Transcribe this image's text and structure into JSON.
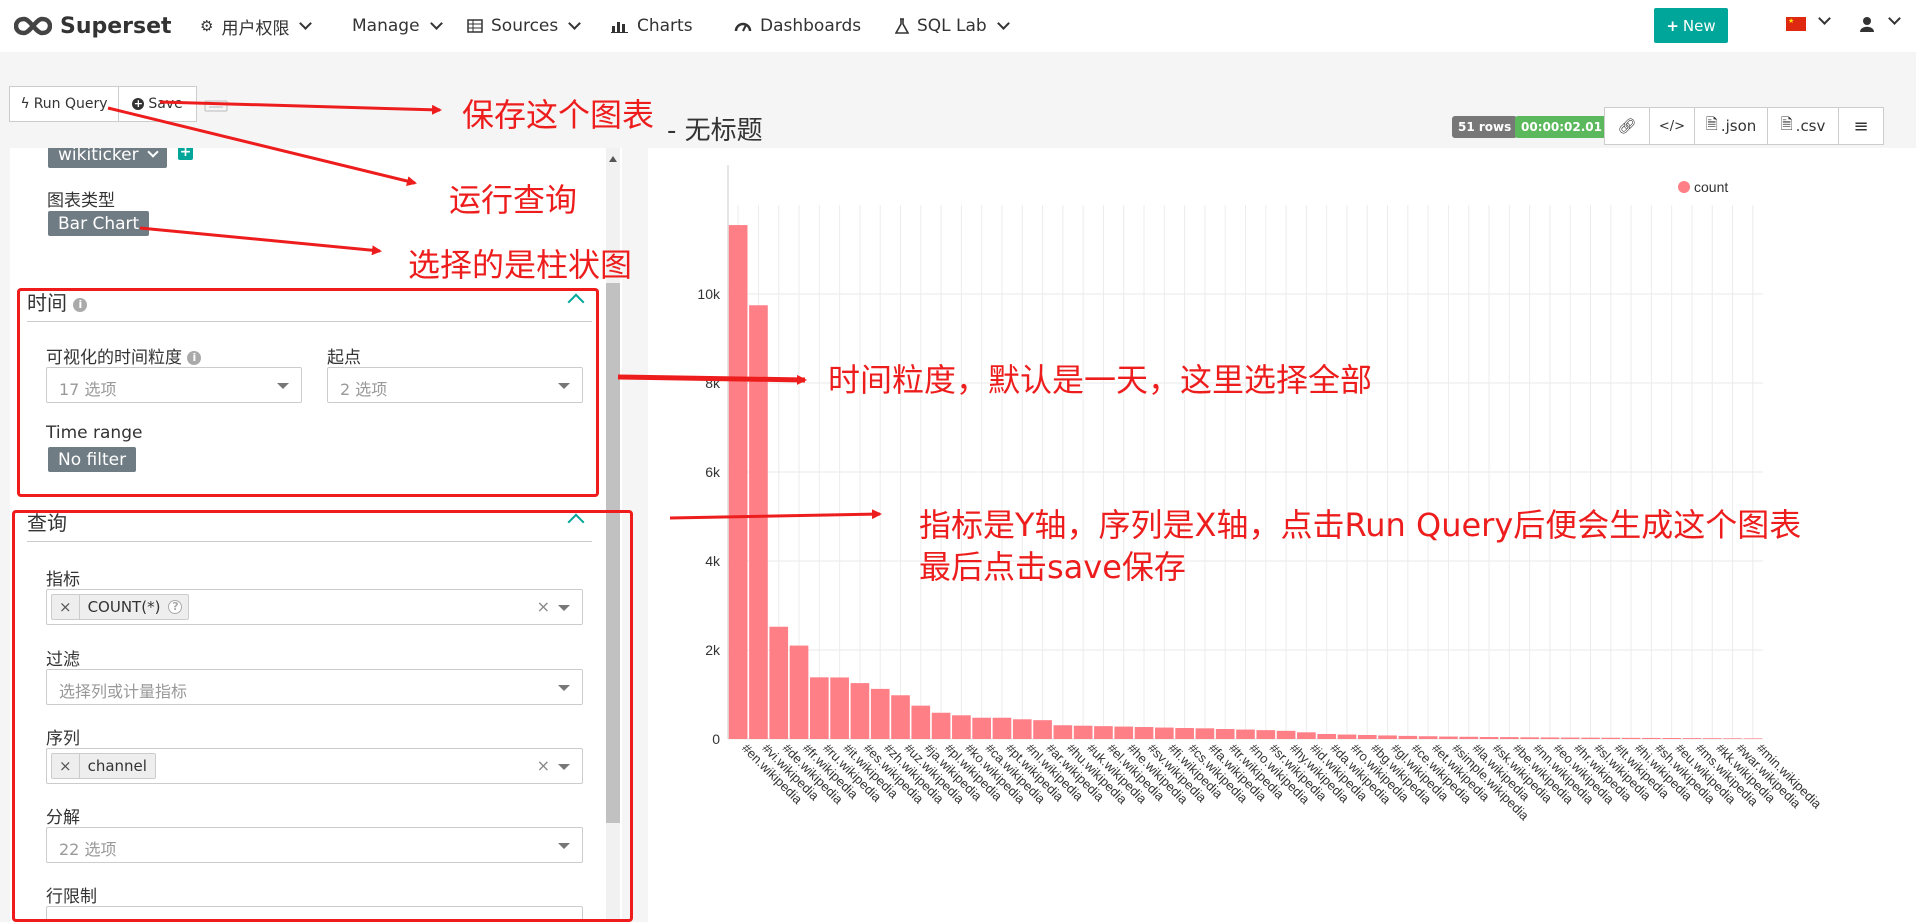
{
  "navbar": {
    "brand": "Superset",
    "items": [
      {
        "label": "用户权限",
        "dropdown": true
      },
      {
        "label": "Manage",
        "dropdown": true
      },
      {
        "label": "Sources",
        "dropdown": true
      },
      {
        "label": "Charts",
        "dropdown": false
      },
      {
        "label": "Dashboards",
        "dropdown": false
      },
      {
        "label": "SQL Lab",
        "dropdown": true
      }
    ],
    "new_button": "New",
    "accent_color": "#00a699"
  },
  "toolbar": {
    "run_query": "Run Query",
    "save": "Save"
  },
  "datasource": {
    "name": "wikiticker"
  },
  "viz": {
    "label": "图表类型",
    "type": "Bar Chart"
  },
  "time_section": {
    "title": "时间",
    "granularity_label": "可视化的时间粒度",
    "granularity_placeholder": "17 选项",
    "since_label": "起点",
    "since_placeholder": "2 选项",
    "time_range_label": "Time range",
    "time_range_value": "No filter"
  },
  "query_section": {
    "title": "查询",
    "metrics_label": "指标",
    "metrics_value": "COUNT(*)",
    "filters_label": "过滤",
    "filters_placeholder": "选择列或计量指标",
    "series_label": "序列",
    "series_value": "channel",
    "breakdown_label": "分解",
    "breakdown_placeholder": "22 选项",
    "row_limit_label": "行限制"
  },
  "chart_header": {
    "title": "- 无标题",
    "rows_badge": "51 rows",
    "time_badge": "00:00:02.01",
    "json_btn": ".json",
    "csv_btn": ".csv"
  },
  "annotations": {
    "save": "保存这个图表",
    "run": "运行查询",
    "chart_type": "选择的是柱状图",
    "time": "时间粒度，默认是一天，这里选择全部",
    "query_line1": "指标是Y轴，序列是X轴，点击Run Query后便会生成这个图表",
    "query_line2": "最后点击save保存",
    "color": "#ee1d1d"
  },
  "chart_data": {
    "type": "bar",
    "legend": "count",
    "legend_position": "top-right",
    "bar_color": "#ff7f87",
    "ylim": [
      0,
      12000
    ],
    "yticks": [
      0,
      2000,
      4000,
      6000,
      8000,
      10000
    ],
    "ytick_labels": [
      "0",
      "2k",
      "4k",
      "6k",
      "8k",
      "10k"
    ],
    "grid": true,
    "categories": [
      "#en.wikipedia",
      "#vi.wikipedia",
      "#de.wikipedia",
      "#fr.wikipedia",
      "#ru.wikipedia",
      "#it.wikipedia",
      "#es.wikipedia",
      "#zh.wikipedia",
      "#uz.wikipedia",
      "#ja.wikipedia",
      "#pl.wikipedia",
      "#ko.wikipedia",
      "#ca.wikipedia",
      "#pt.wikipedia",
      "#nl.wikipedia",
      "#ar.wikipedia",
      "#hu.wikipedia",
      "#uk.wikipedia",
      "#el.wikipedia",
      "#he.wikipedia",
      "#sv.wikipedia",
      "#fi.wikipedia",
      "#cs.wikipedia",
      "#fa.wikipedia",
      "#tr.wikipedia",
      "#no.wikipedia",
      "#sr.wikipedia",
      "#hy.wikipedia",
      "#id.wikipedia",
      "#da.wikipedia",
      "#ro.wikipedia",
      "#bg.wikipedia",
      "#gl.wikipedia",
      "#ce.wikipedia",
      "#et.wikipedia",
      "#simple.wikipedia",
      "#la.wikipedia",
      "#sk.wikipedia",
      "#be.wikipedia",
      "#nn.wikipedia",
      "#eo.wikipedia",
      "#hr.wikipedia",
      "#sl.wikipedia",
      "#lt.wikipedia",
      "#hi.wikipedia",
      "#sh.wikipedia",
      "#eu.wikipedia",
      "#ms.wikipedia",
      "#kk.wikipedia",
      "#war.wikipedia",
      "#min.wikipedia"
    ],
    "values": [
      11549,
      9747,
      2523,
      2099,
      1386,
      1383,
      1256,
      1126,
      983,
      749,
      590,
      533,
      478,
      478,
      443,
      423,
      309,
      299,
      289,
      279,
      269,
      257,
      247,
      240,
      224,
      212,
      199,
      184,
      150,
      112,
      100,
      90,
      80,
      70,
      62,
      55,
      50,
      45,
      42,
      38,
      35,
      32,
      30,
      28,
      26,
      24,
      22,
      20,
      18,
      16,
      14
    ]
  }
}
